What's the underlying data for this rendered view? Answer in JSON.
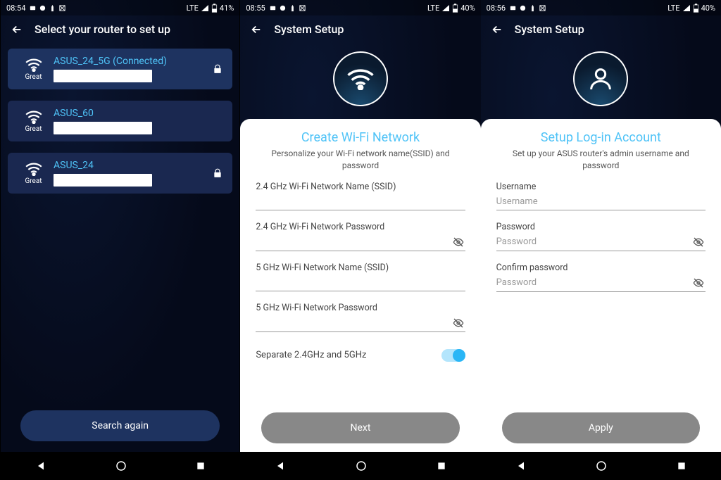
{
  "screens": [
    {
      "status": {
        "time": "08:54",
        "net": "LTE",
        "battery": "41%"
      },
      "title": "Select your router to set up",
      "routers": [
        {
          "name": "ASUS_24_5G (Connected)",
          "signal": "Great",
          "locked": true
        },
        {
          "name": "ASUS_60",
          "signal": "Great",
          "locked": false
        },
        {
          "name": "ASUS_24",
          "signal": "Great",
          "locked": true
        }
      ],
      "search_btn": "Search again"
    },
    {
      "status": {
        "time": "08:55",
        "net": "LTE",
        "battery": "40%"
      },
      "title": "System Setup",
      "panel_title": "Create Wi-Fi Network",
      "panel_sub": "Personalize your Wi-Fi network name(SSID) and password",
      "fields": {
        "ssid24": "2.4 GHz Wi-Fi Network Name (SSID)",
        "pwd24": "2.4 GHz Wi-Fi Network Password",
        "ssid5": "5 GHz Wi-Fi Network Name (SSID)",
        "pwd5": "5 GHz Wi-Fi Network Password"
      },
      "toggle_label": "Separate 2.4GHz and 5GHz",
      "next_btn": "Next"
    },
    {
      "status": {
        "time": "08:56",
        "net": "LTE",
        "battery": "40%"
      },
      "title": "System Setup",
      "panel_title": "Setup Log-in Account",
      "panel_sub": "Set up your ASUS router's admin username and password",
      "fields": {
        "user_label": "Username",
        "user_ph": "Username",
        "pwd_label": "Password",
        "pwd_ph": "Password",
        "cpwd_label": "Confirm password",
        "cpwd_ph": "Password"
      },
      "apply_btn": "Apply"
    }
  ]
}
